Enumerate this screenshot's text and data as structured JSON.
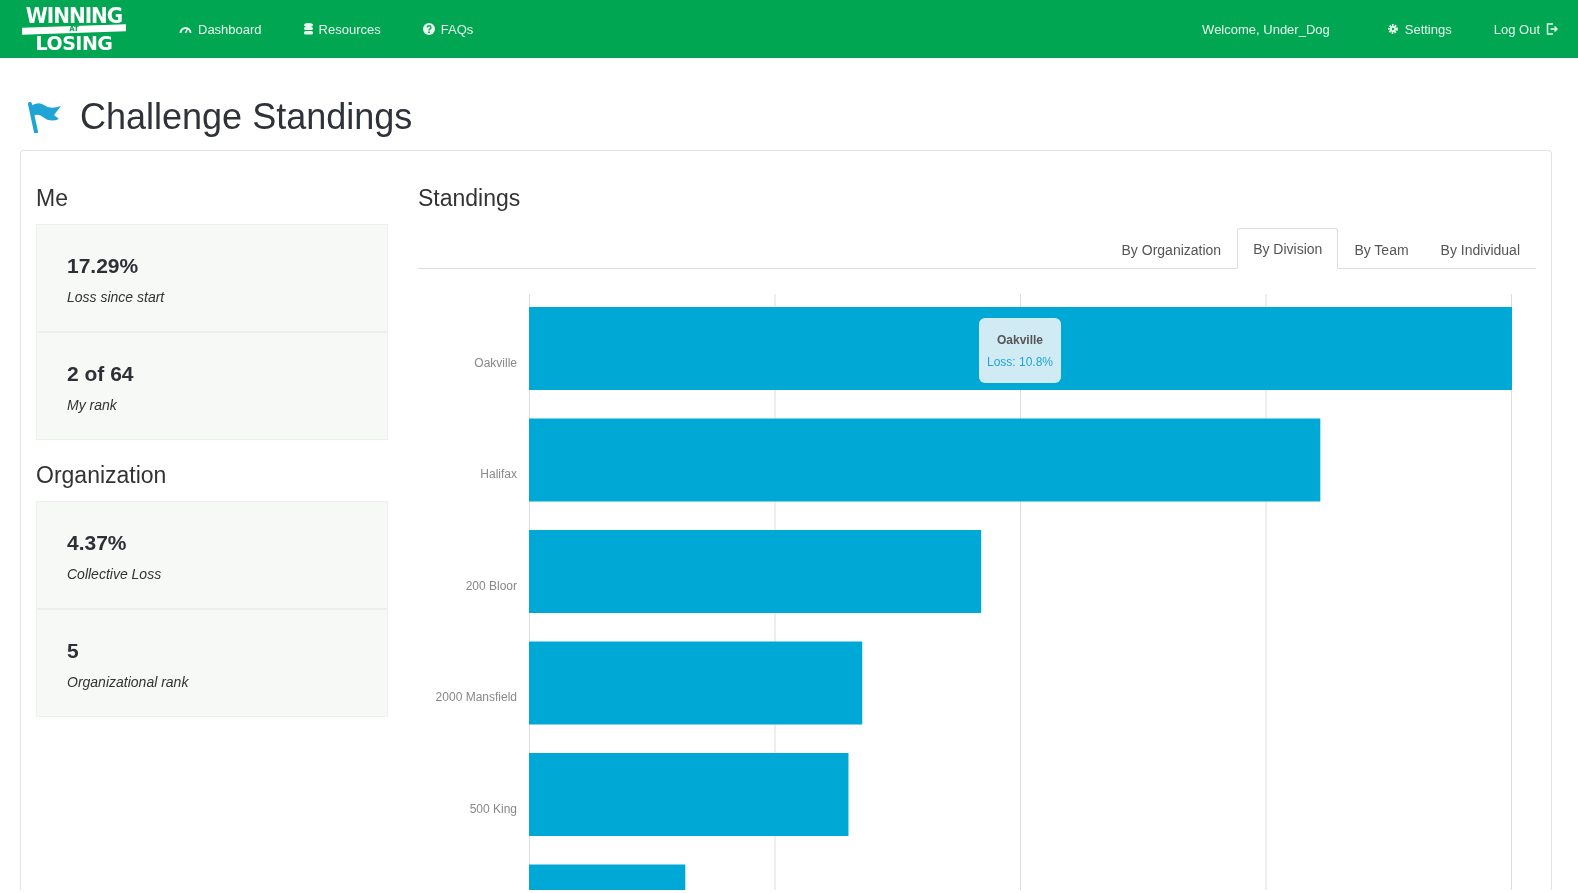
{
  "navbar": {
    "logo": {
      "line_1": "WINNING",
      "line_2": "AT",
      "line_3": "LOSING"
    },
    "links": [
      {
        "label": "Dashboard"
      },
      {
        "label": "Resources"
      },
      {
        "label": "FAQs"
      }
    ],
    "welcome": "Welcome, Under_Dog",
    "settings": "Settings",
    "logout": "Log Out"
  },
  "page_title": "Challenge Standings",
  "me": {
    "heading": "Me",
    "stats": [
      {
        "value": "17.29%",
        "label": "Loss since start"
      },
      {
        "value": "2 of 64",
        "label": "My rank"
      }
    ]
  },
  "organization": {
    "heading": "Organization",
    "stats": [
      {
        "value": "4.37%",
        "label": "Collective Loss"
      },
      {
        "value": "5",
        "label": "Organizational rank"
      }
    ]
  },
  "standings": {
    "heading": "Standings",
    "tabs": [
      {
        "label": "By Organization",
        "selected": false
      },
      {
        "label": "By Division",
        "selected": true
      },
      {
        "label": "By Team",
        "selected": false
      },
      {
        "label": "By Individual",
        "selected": false
      }
    ],
    "chart": {
      "categories": [
        "Oakville",
        "Halifax",
        "200 Bloor",
        "2000 Mansfield",
        "500 King"
      ],
      "tooltip": {
        "title": "Oakville",
        "text": "Loss: 10.8%"
      }
    }
  }
}
